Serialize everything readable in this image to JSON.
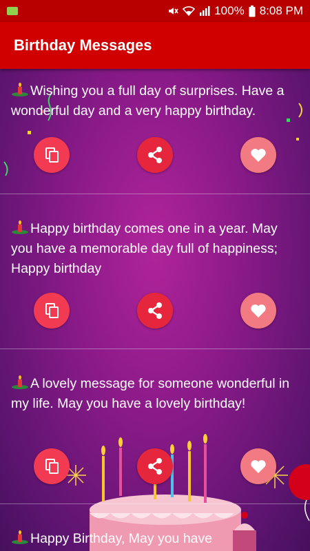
{
  "status_bar": {
    "battery": "100%",
    "time": "8:08 PM"
  },
  "app_bar": {
    "title": "Birthday Messages"
  },
  "messages": [
    {
      "text": "Wishing you a full day of surprises. Have a wonderful day and a very happy birthday."
    },
    {
      "text": "Happy birthday comes one in a year. May you have a memorable day full of happiness; Happy birthday"
    },
    {
      "text": "A lovely message for someone wonderful in my life. May you have a lovely birthday!"
    },
    {
      "text": "Happy Birthday, May you have"
    }
  ],
  "icons": {
    "copy": "copy-icon",
    "share": "share-icon",
    "favorite": "heart-icon",
    "bullet": "candle-icon"
  },
  "colors": {
    "status_bar": "#b80000",
    "app_bar": "#d10000",
    "copy_button": "#f23a52",
    "share_button": "#e5263d",
    "favorite_button": "#f27a82"
  }
}
